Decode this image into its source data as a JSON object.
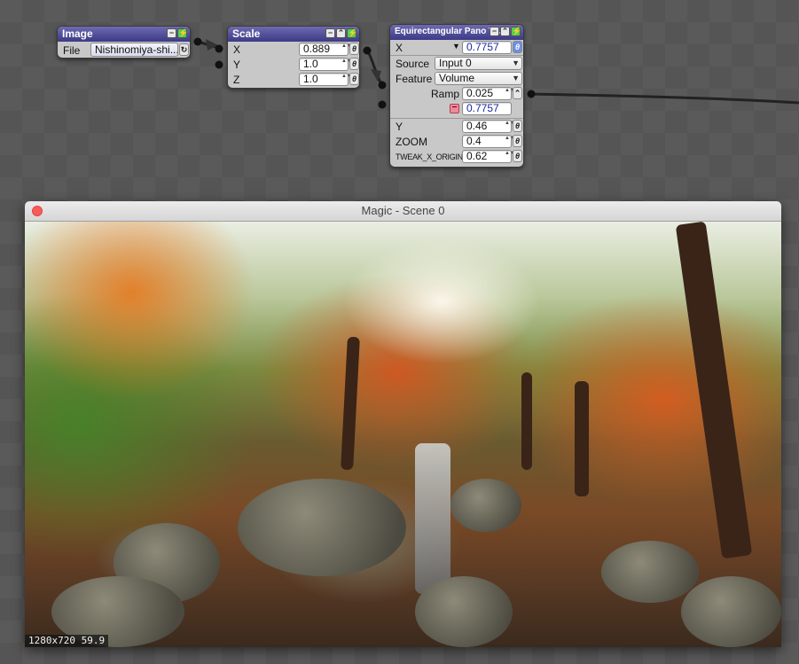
{
  "nodes": {
    "image": {
      "title": "Image",
      "file_label": "File",
      "file_value": "Nishinomiya-shi..."
    },
    "scale": {
      "title": "Scale",
      "params": [
        {
          "label": "X",
          "value": "0.889"
        },
        {
          "label": "Y",
          "value": "1.0"
        },
        {
          "label": "Z",
          "value": "1.0"
        }
      ]
    },
    "pano": {
      "title": "Equirectangular Pano V...",
      "x_label": "X",
      "x_value": "0.7757",
      "source_label": "Source",
      "source_value": "Input 0",
      "feature_label": "Feature",
      "feature_value": "Volume",
      "ramp_label": "Ramp",
      "ramp_value": "0.025",
      "ramp_output": "0.7757",
      "params": [
        {
          "label": "Y",
          "value": "0.46"
        },
        {
          "label": "ZOOM",
          "value": "0.4"
        },
        {
          "label": "TWEAK_X_ORIGIN",
          "value": "0.62"
        }
      ]
    }
  },
  "icons": {
    "collapse": "−",
    "publish": "⌃",
    "enable": "⚡",
    "link": "θ",
    "stepper": "▲▼",
    "dropdown": "▼",
    "refresh": "↻",
    "minus": "−"
  },
  "window": {
    "title": "Magic - Scene 0",
    "hud": "1280x720  59.9"
  },
  "colors": {
    "node_header": "#3c3a86",
    "close_button": "#f95d58",
    "enable_green": "#4fd14f",
    "linked_blue": "#6d8fe8"
  }
}
